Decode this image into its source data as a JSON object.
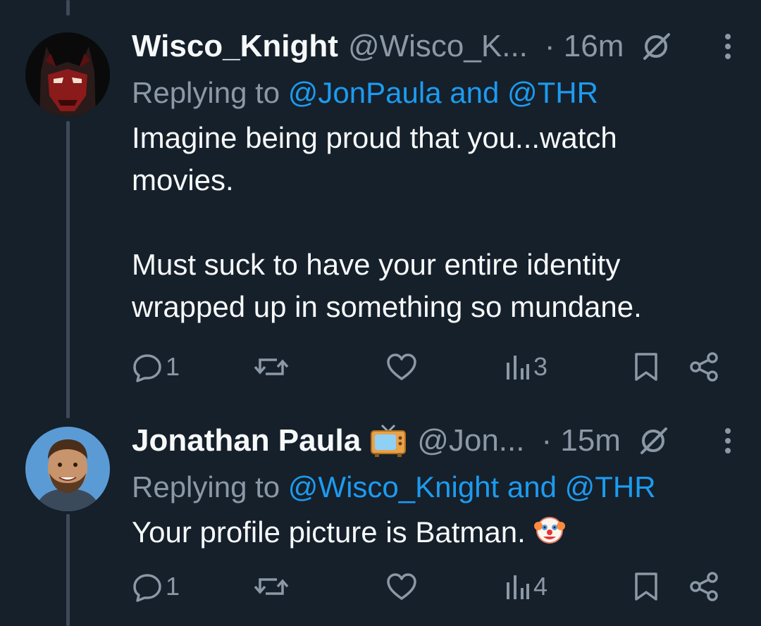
{
  "tweets": [
    {
      "display_name": "Wisco_Knight",
      "handle": "@Wisco_K...",
      "time": "· 16m",
      "replying_prefix": "Replying to",
      "replying_targets": "@JonPaula and @THR",
      "text": "Imagine being proud that you...watch\nmovies.\n\nMust suck to have your entire identity\nwrapped up in something so mundane.",
      "reply_count": "1",
      "view_count": "3",
      "avatar": "batman-avatar"
    },
    {
      "display_name": "Jonathan Paula",
      "handle": "@Jon...",
      "time": "· 15m",
      "replying_prefix": "Replying to",
      "replying_targets": "@Wisco_Knight and @THR",
      "text": "Your profile picture is Batman.",
      "reply_count": "1",
      "view_count": "4",
      "avatar": "man-avatar"
    }
  ],
  "colors": {
    "background": "#15202b",
    "text": "#f7f9f9",
    "muted": "#8b98a5",
    "accent": "#1d9bf0",
    "thread_line": "#3d4a57"
  },
  "icons": [
    "verified-off-icon",
    "more-icon",
    "reply-icon",
    "retweet-icon",
    "like-icon",
    "views-icon",
    "bookmark-icon",
    "share-icon",
    "tv-icon",
    "clown-icon"
  ]
}
